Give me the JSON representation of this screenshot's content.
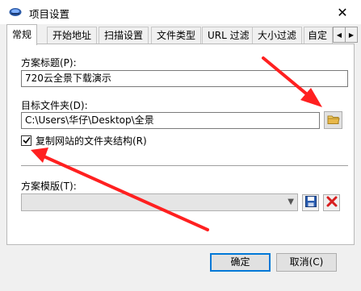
{
  "window": {
    "title": "项目设置",
    "close_glyph": "✕"
  },
  "tabs": [
    {
      "label": "常规",
      "active": true
    },
    {
      "label": "开始地址"
    },
    {
      "label": "扫描设置"
    },
    {
      "label": "文件类型"
    },
    {
      "label": "URL 过滤"
    },
    {
      "label": "大小过滤"
    },
    {
      "label": "自定"
    }
  ],
  "tab_scroll": {
    "left": "◀",
    "right": "▶"
  },
  "general": {
    "project_title_label": "方案标题(P):",
    "project_title_value": "720云全景下载演示",
    "target_folder_label": "目标文件夹(D):",
    "target_folder_value": "C:\\Users\\华仔\\Desktop\\全景",
    "copy_structure_label": "复制网站的文件夹结构(R)",
    "copy_structure_checked": true,
    "template_label": "方案模版(T):",
    "template_value": ""
  },
  "footer": {
    "ok_label": "确定",
    "cancel_label": "取消(C)"
  },
  "colors": {
    "annotation_arrow": "#ff2020",
    "folder_icon": "#e8b84a",
    "save_icon": "#2a5db0",
    "delete_icon": "#d81e1e"
  },
  "icons": {
    "app": "app-icon",
    "folder": "folder-icon",
    "save": "save-icon",
    "delete": "delete-icon"
  }
}
